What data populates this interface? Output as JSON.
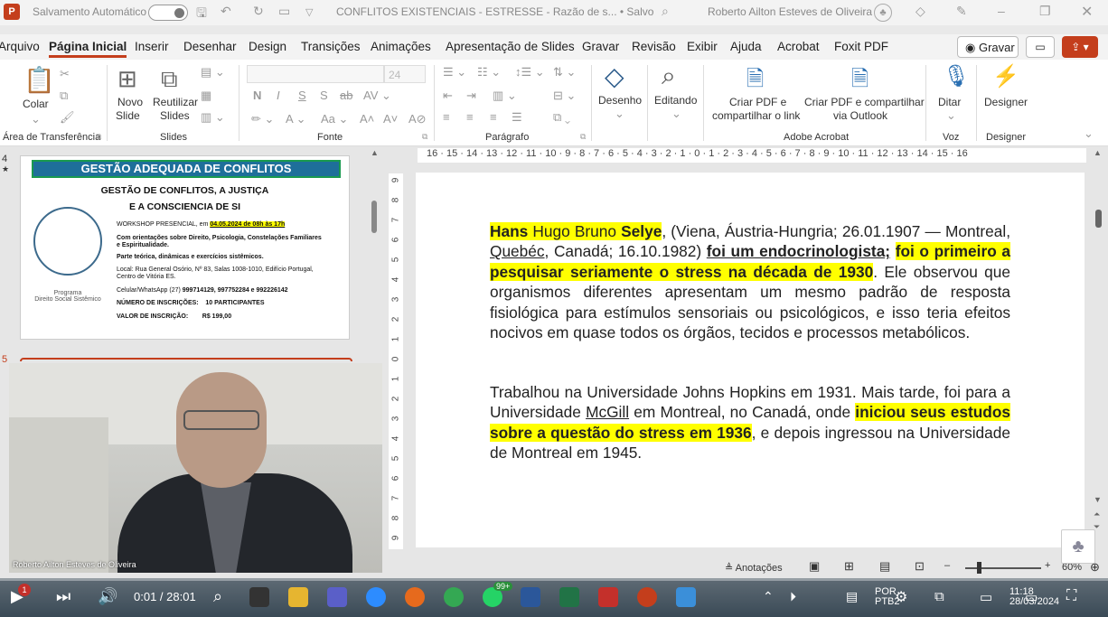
{
  "titlebar": {
    "autosave_label": "Salvamento Automático",
    "document_title": "CONFLITOS EXISTENCIAIS - ESTRESSE - Razão de s... • Salvo",
    "user_name": "Roberto Ailton Esteves de Oliveira"
  },
  "menu": {
    "tabs": [
      "Arquivo",
      "Página Inicial",
      "Inserir",
      "Desenhar",
      "Design",
      "Transições",
      "Animações",
      "Apresentação de Slides",
      "Gravar",
      "Revisão",
      "Exibir",
      "Ajuda",
      "Acrobat",
      "Foxit PDF"
    ],
    "record_label": "Gravar"
  },
  "ribbon": {
    "paste": "Colar",
    "new_slide": [
      "Novo",
      "Slide"
    ],
    "reuse_slides": [
      "Reutilizar",
      "Slides"
    ],
    "font_size": "24",
    "draw": "Desenho",
    "editing": "Editando",
    "pdf_share_link": [
      "Criar PDF e",
      "compartilhar o link"
    ],
    "pdf_share_outlook": [
      "Criar PDF e compartilhar",
      "via Outlook"
    ],
    "dictate": "Ditar",
    "designer": "Designer",
    "groups": {
      "clipboard": "Área de Transferência",
      "slides": "Slides",
      "font": "Fonte",
      "paragraph": "Parágrafo",
      "acrobat": "Adobe Acrobat",
      "voice": "Voz",
      "designer": "Designer"
    }
  },
  "thumbnail": {
    "slide_number": "4",
    "second_slide_number": "5",
    "header": "GESTÃO ADEQUADA DE CONFLITOS",
    "title_line1": "GESTÃO DE CONFLITOS, A JUSTIÇA",
    "title_line2": "E A CONSCIENCIA DE SI",
    "workshop_prefix": "WORKSHOP PRESENCIAL, em ",
    "workshop_date": "04.05.2024 de 08h às 17h",
    "orientations": [
      "Com orientações sobre Direito, Psicologia, Constelações Familiares",
      "e Espiritualidade."
    ],
    "practice": "Parte teórica, dinâmicas e exercícios sistêmicos.",
    "location": [
      "Local: Rua General Osório, Nº 83, Salas 1008-1010, Edifício Portugal,",
      "Centro de Vitória ES."
    ],
    "phone_prefix": "Celular/WhatsApp (27) ",
    "phone": "999714129, 997752284 e 992226142",
    "enrollment_label": "NÚMERO DE INSCRIÇÕES:",
    "enrollment_value": "10 PARTICIPANTES",
    "price_label": "VALOR DE INSCRIÇÃO:",
    "price_value": "R$ 199,00",
    "logo_caption": [
      "Programa",
      "Direito Social Sistêmico"
    ]
  },
  "video": {
    "speaker_name": "Roberto Ailton Esteves de Oliveira"
  },
  "ruler": {
    "horizontal": "16 · 15 · 14 · 13 · 12 · 11 · 10 · 9 · 8 · 7 · 6 · 5 · 4 · 3 · 2 · 1 · 0 · 1 · 2 · 3 · 4 · 5 · 6 · 7 · 8 · 9 · 10 · 11 · 12 · 13 · 14 · 15 · 16",
    "vertical": [
      "9",
      "8",
      "7",
      "6",
      "5",
      "4",
      "3",
      "2",
      "1",
      "0",
      "1",
      "2",
      "3",
      "4",
      "5",
      "6",
      "7",
      "8",
      "9"
    ]
  },
  "slide": {
    "p1": {
      "s1": "Hans",
      "s2": " Hugo Bruno ",
      "s3": "Selye",
      "s4": ", (Viena, Áustria-Hungria; 26.01.1907 — Montreal, ",
      "s5": "Quebéc",
      "s6": ", Canadá; 16.10.1982) ",
      "s7": "foi um endocrinologista;",
      "s8": " ",
      "s9": "foi o primeiro a pesquisar seriamente o stress na década de 1930",
      "s10": ". Ele observou que organismos diferentes apresentam um mesmo padrão de resposta fisiológica para estímulos sensoriais ou psicológicos, e isso teria efeitos nocivos em quase todos os órgãos, tecidos e processos metabólicos."
    },
    "p2": {
      "s1": "Trabalhou na Universidade Johns Hopkins em 1931. Mais tarde, foi para a Universidade ",
      "s2": "McGill",
      "s3": " em Montreal, no Canadá, onde ",
      "s4": "iniciou seus estudos sobre a questão do stress em 1936",
      "s5": ", e depois ingressou na Universidade de Montreal em 1945."
    }
  },
  "statusbar": {
    "notes": "Anotações",
    "zoom": "60%"
  },
  "player": {
    "time": "0:01 / 28:01",
    "notification_badge": "99+",
    "tray_lang": [
      "POR",
      "PTB2"
    ],
    "tray_time": [
      "11:18",
      "28/03/2024"
    ]
  }
}
